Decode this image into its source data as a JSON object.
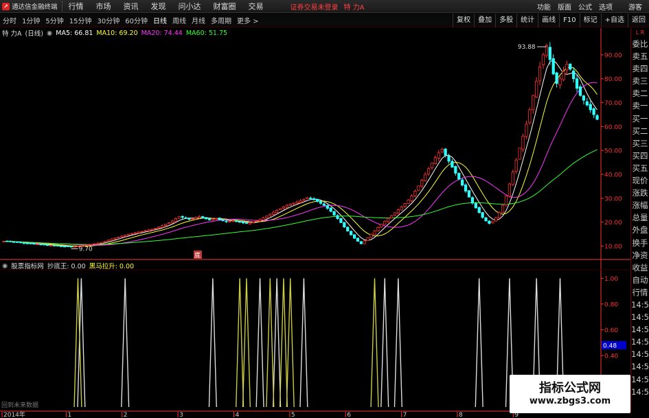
{
  "menubar": {
    "app_title": "通达信金融终端",
    "menus": [
      "行情",
      "市场",
      "资讯",
      "发现",
      "问小达",
      "财富圈",
      "交易"
    ],
    "notice": "证券交易未登录",
    "stock_name": "特 力A",
    "right_items": [
      "功能",
      "版面",
      "公式",
      "选项"
    ],
    "guest": "游客"
  },
  "toolbar": {
    "periods": [
      "分时",
      "1分钟",
      "5分钟",
      "15分钟",
      "30分钟",
      "60分钟",
      "日线",
      "周线",
      "月线",
      "多周期",
      "更多 >"
    ],
    "active_period": "日线",
    "right_buttons": [
      "复权",
      "叠加",
      "多股",
      "统计",
      "画线",
      "F10",
      "标记",
      "+自选",
      "返回"
    ]
  },
  "main_header": {
    "stock": "特 力A",
    "period": "(日线)",
    "ma": [
      {
        "label": "MA5: 66.81",
        "color": "#ffffff"
      },
      {
        "label": "MA10: 69.20",
        "color": "#ffff33"
      },
      {
        "label": "MA20: 74.44",
        "color": "#ff33ff"
      },
      {
        "label": "MA60: 51.75",
        "color": "#33ff33"
      }
    ]
  },
  "sub_header": {
    "name": "股票指标网",
    "ind1": "抄底王: 0.00",
    "ind2": "黑马拉升: 0.00"
  },
  "chart_data": [
    {
      "type": "candlestick",
      "title": "特 力A (日线)",
      "price_axis": [
        90.0,
        80.0,
        70.0,
        60.0,
        50.0,
        40.0,
        30.0,
        20.0,
        10.0
      ],
      "ylim": [
        5,
        96
      ],
      "max_label": "93.88",
      "min_label": "9.70",
      "mark_label": "底",
      "x_labels": [
        "2014年",
        "1",
        "2",
        "3",
        "4",
        "5",
        "6",
        "7",
        "8",
        "9"
      ],
      "series": [
        {
          "name": "MA5",
          "color": "#ffffff",
          "value": 66.81
        },
        {
          "name": "MA10",
          "color": "#ffff33",
          "value": 69.2
        },
        {
          "name": "MA20",
          "color": "#ff33ff",
          "value": 74.44
        },
        {
          "name": "MA60",
          "color": "#33ff33",
          "value": 51.75
        }
      ],
      "closes": [
        12,
        12.1,
        11.9,
        11.7,
        11.6,
        11.4,
        11.3,
        11.1,
        11,
        10.9,
        10.8,
        10.6,
        10.5,
        10.4,
        10.3,
        10.2,
        10.1,
        10,
        9.9,
        9.8,
        9.7,
        9.8,
        10,
        10.2,
        10.4,
        10.6,
        10.8,
        11,
        11.3,
        11.6,
        12,
        12.5,
        13,
        13.4,
        13.8,
        14.2,
        14.6,
        15,
        15.3,
        15.6,
        15.9,
        16.2,
        16.5,
        16.8,
        17.1,
        17.5,
        18,
        18.6,
        19.2,
        19.8,
        20.5,
        21.5,
        22.3,
        22,
        21.6,
        21.2,
        21.5,
        22,
        22.4,
        21.8,
        21.4,
        21,
        21.3,
        21.6,
        21,
        20.6,
        20.2,
        20.4,
        20.7,
        20.3,
        20,
        19.7,
        19.5,
        19.8,
        20.2,
        20.6,
        21.1,
        21.8,
        22.6,
        23.4,
        24.2,
        25,
        25.7,
        26.4,
        27,
        27.5,
        28,
        28.5,
        29,
        29.6,
        30.3,
        30,
        29.4,
        28.7,
        27.9,
        27,
        25.8,
        24.5,
        23,
        21.5,
        19.8,
        18,
        16.3,
        14.7,
        13.3,
        12,
        11,
        12.2,
        13.6,
        15,
        16.4,
        17.8,
        19.2,
        20.4,
        21.6,
        22.8,
        24,
        25.2,
        26.4,
        27.8,
        29.3,
        31,
        33,
        35.2,
        37.6,
        40,
        42.4,
        44.8,
        47,
        49,
        50.5,
        48,
        45.5,
        43,
        40.5,
        38,
        35.5,
        33,
        30.5,
        28,
        26,
        24,
        22,
        20.5,
        19.5,
        20.5,
        22,
        24,
        27,
        31,
        36,
        41,
        46,
        51,
        56,
        61,
        67,
        73,
        79,
        85,
        90,
        93.88,
        88,
        82,
        78,
        80,
        83,
        86,
        84,
        80,
        76,
        73,
        71,
        69,
        67,
        65,
        63
      ],
      "indicator": {
        "name": "抄底王 / 黑马拉升",
        "ticks": [
          1.0,
          0.8,
          0.6,
          0.4
        ],
        "ylim": [
          0,
          1.05
        ],
        "current": "0.48",
        "spikes_white": [
          23,
          36,
          62,
          76,
          81,
          89,
          113,
          117,
          141,
          150,
          158,
          165
        ],
        "spikes_yellow": [
          22,
          70,
          72,
          79,
          83,
          85,
          110
        ]
      }
    }
  ],
  "quote_panel": {
    "corner": "L R",
    "items": [
      "委比",
      "卖五",
      "卖四",
      "卖三",
      "卖二",
      "卖一",
      "买一",
      "买二",
      "买三",
      "买四",
      "买五",
      "现价",
      "涨跌",
      "涨幅",
      "总量",
      "外盘",
      "换手",
      "净资",
      "收益",
      "自动",
      "行情",
      "14:5",
      "14:5",
      "14:5",
      "14:5",
      "14:5",
      "14:5",
      "14:5",
      "14:5"
    ]
  },
  "watermark": {
    "line1": "指标公式网",
    "line2": "www.zbgs3.com"
  },
  "footnote": "回到未来数据",
  "colors": {
    "up": "#ff3333",
    "down": "#33ffff",
    "grid": "#5a0000",
    "axis": "#ff3333"
  }
}
